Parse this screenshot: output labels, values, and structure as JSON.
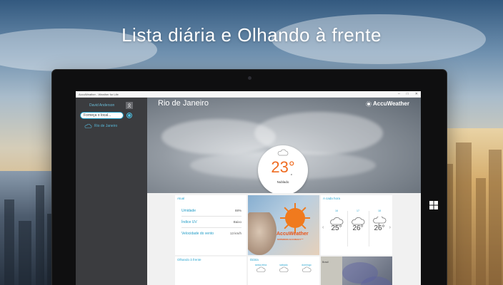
{
  "headline": "Lista diária e Olhando à frente",
  "window": {
    "title": "AccuWeather - Weather for Life",
    "controls": [
      "–",
      "□",
      "✕"
    ]
  },
  "sidebar": {
    "user_name": "David Anderson",
    "search_placeholder": "Forneça o local...",
    "locations": [
      {
        "label": "Rio de Janeiro"
      }
    ]
  },
  "hero": {
    "city": "Rio de Janeiro",
    "brand": "AccuWeather",
    "temperature": "23°",
    "unit": "c",
    "condition": "Nublado"
  },
  "atual": {
    "title": "Atual",
    "rows": [
      {
        "label": "Umidade",
        "value": "88%"
      },
      {
        "label": "Índice UV",
        "value": "Baixo"
      },
      {
        "label": "Velocidade do vento",
        "value": "13 km/h"
      }
    ]
  },
  "ad": {
    "brand": "AccuWeather",
    "tagline": "SUPERIOR ACCURACY™"
  },
  "hourly": {
    "title": "A cada hora",
    "hours": [
      {
        "label": "16",
        "temp": "25°",
        "icon": "cloud-icon"
      },
      {
        "label": "17",
        "temp": "26°",
        "icon": "cloud-icon"
      },
      {
        "label": "18",
        "temp": "26°",
        "icon": "thunderstorm-icon"
      }
    ]
  },
  "frente": {
    "title": "Olhando à frente"
  },
  "diaria": {
    "title": "Diária",
    "days": [
      "sexta-feira",
      "sábado",
      "domingo"
    ]
  },
  "mapa": {
    "title": "Brasil"
  },
  "colors": {
    "accent": "#2aa6d0",
    "temp": "#ef6c22",
    "sidebar": "#3b3c3f"
  }
}
